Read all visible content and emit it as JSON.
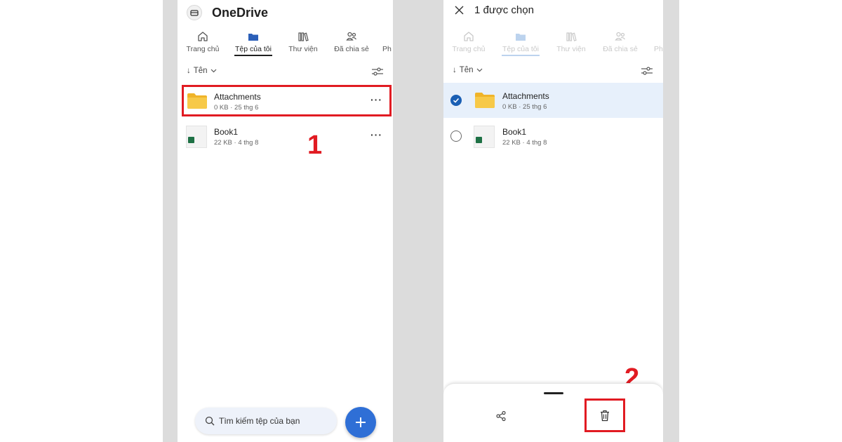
{
  "left": {
    "app_title": "OneDrive",
    "tabs": [
      {
        "label": "Trang chủ",
        "icon": "home-icon"
      },
      {
        "label": "Tệp của tôi",
        "icon": "folder-icon",
        "active": true
      },
      {
        "label": "Thư viện",
        "icon": "library-icon"
      },
      {
        "label": "Đã chia sẻ",
        "icon": "people-icon"
      },
      {
        "label": "Ph",
        "icon": ""
      }
    ],
    "sort_label": "Tên",
    "files": [
      {
        "name": "Attachments",
        "meta": "0 KB · 25 thg 6",
        "type": "folder"
      },
      {
        "name": "Book1",
        "meta": "22 KB · 4 thg 8",
        "type": "excel"
      }
    ],
    "more_label": "···",
    "search_placeholder": "Tìm kiếm tệp của bạn",
    "step_number": "1"
  },
  "right": {
    "selection_title": "1 được chọn",
    "tabs": [
      {
        "label": "Trang chủ"
      },
      {
        "label": "Tệp của tôi"
      },
      {
        "label": "Thư viện"
      },
      {
        "label": "Đã chia sẻ"
      },
      {
        "label": "Ph"
      }
    ],
    "sort_label": "Tên",
    "files": [
      {
        "name": "Attachments",
        "meta": "0 KB · 25 thg 6",
        "selected": true
      },
      {
        "name": "Book1",
        "meta": "22 KB · 4 thg 8",
        "selected": false
      }
    ],
    "step_number": "2"
  },
  "colors": {
    "accent": "#2f6fd6",
    "highlight": "#e11b22",
    "selected_row": "#e7f0fb",
    "folder": "#f6c343"
  }
}
